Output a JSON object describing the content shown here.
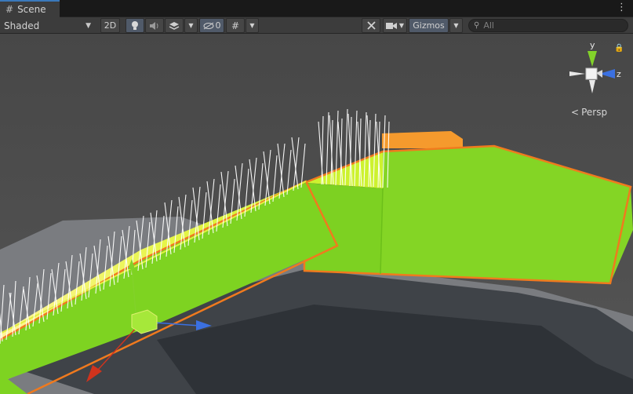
{
  "tab": {
    "label": "Scene",
    "icon": "grid-icon"
  },
  "toolbar": {
    "shading_mode": "Shaded",
    "mode_2d": "2D",
    "hidden_count": "0",
    "gizmos_label": "Gizmos",
    "search_placeholder": "All"
  },
  "view_gizmo": {
    "y_label": "y",
    "z_label": "z",
    "projection_label": "Persp"
  },
  "colors": {
    "tab_accent": "#3a79bb",
    "toolbar_bg": "#3c3c3c",
    "sky": "#4a4a4a",
    "ground": "#7b7d80",
    "platform_green": "#7ed321",
    "platform_top": "#c8f52a",
    "edge_orange": "#f07a1e",
    "grass_white": "#ffffff",
    "axis_x": "#d0331d",
    "axis_y": "#82d22a",
    "axis_z": "#3b70e0"
  }
}
